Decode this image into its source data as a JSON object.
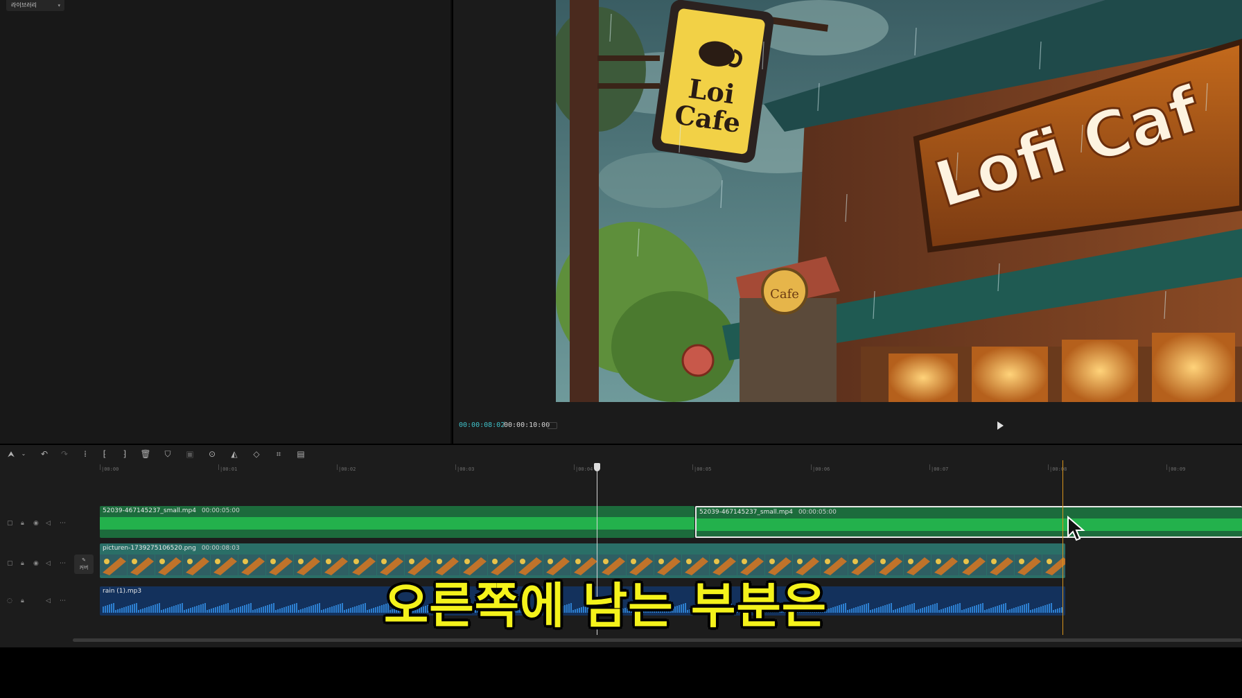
{
  "library": {
    "tab_label": "라이브러리"
  },
  "player": {
    "current_time": "00:00:08:02",
    "total_time": "00:00:10:00",
    "sign_text_1": "Loi",
    "sign_text_2": "Cafe",
    "banner_text": "Lofi Caf",
    "small_sign_text": "Cafe"
  },
  "timeline": {
    "ruler": [
      "00:00",
      "00:01",
      "00:02",
      "00:03",
      "00:04",
      "00:05",
      "00:06",
      "00:07",
      "00:08",
      "00:09"
    ],
    "tracks": {
      "video": {
        "clip_a_name": "52039-467145237_small.mp4",
        "clip_a_duration": "00:00:05:00",
        "clip_b_name": "52039-467145237_small.mp4",
        "clip_b_duration": "00:00:05:00"
      },
      "image": {
        "clip_name": "picturen-1739275106520.png",
        "clip_duration": "00:00:08:03"
      },
      "audio": {
        "clip_name": "rain (1).mp3"
      }
    },
    "cover_label": "커버",
    "colors": {
      "video_clip": "#1c6b3c",
      "waveform": "#23b14c",
      "image_clip": "#2a6f67",
      "audio_clip": "#13315c",
      "marker": "#d9951c"
    }
  },
  "subtitle": {
    "text": "오른쪽에 남는 부분은"
  },
  "icons": [
    "select-arrow-icon",
    "undo-icon",
    "redo-icon",
    "split-icon",
    "split-left-icon",
    "split-right-icon",
    "delete-icon",
    "mark-icon",
    "freeze-icon",
    "reverse-icon",
    "mirror-icon",
    "rotate-icon",
    "crop-icon",
    "fit-icon",
    "play-icon"
  ]
}
